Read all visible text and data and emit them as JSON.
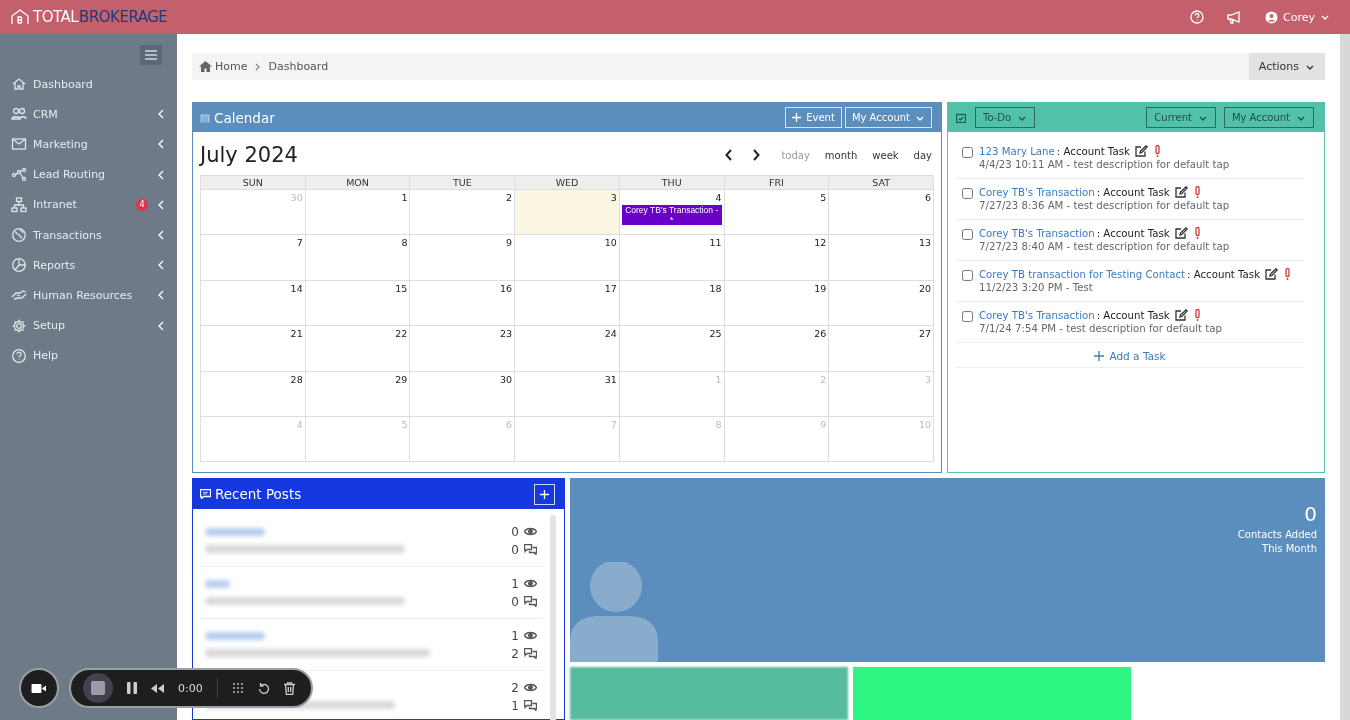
{
  "topbar": {
    "logo_primary": "TOTAL",
    "logo_secondary": "BROKERAGE",
    "user": "Corey"
  },
  "sidebar": {
    "items": [
      {
        "label": "Dashboard",
        "submenu": false
      },
      {
        "label": "CRM",
        "submenu": true
      },
      {
        "label": "Marketing",
        "submenu": true
      },
      {
        "label": "Lead Routing",
        "submenu": true
      },
      {
        "label": "Intranet",
        "submenu": true,
        "badge": "4"
      },
      {
        "label": "Transactions",
        "submenu": true
      },
      {
        "label": "Reports",
        "submenu": true
      },
      {
        "label": "Human Resources",
        "submenu": true
      },
      {
        "label": "Setup",
        "submenu": true
      },
      {
        "label": "Help",
        "submenu": false
      }
    ]
  },
  "breadcrumb": [
    "Home",
    "Dashboard"
  ],
  "actions_button": "Actions",
  "calendar": {
    "title": "Calendar",
    "event_button": "Event",
    "account_button": "My Account",
    "month": "July 2024",
    "nav": [
      {
        "label": "today",
        "disabled": true
      },
      {
        "label": "month",
        "disabled": false
      },
      {
        "label": "week",
        "disabled": false
      },
      {
        "label": "day",
        "disabled": false
      }
    ],
    "weekdays": [
      "SUN",
      "MON",
      "TUE",
      "WED",
      "THU",
      "FRI",
      "SAT"
    ],
    "weeks": [
      [
        {
          "day": "30",
          "other_month": true
        },
        {
          "day": "1"
        },
        {
          "day": "2"
        },
        {
          "day": "3",
          "today": true
        },
        {
          "day": "4",
          "events": [
            {
              "title": "Corey TB's Transaction - *",
              "color": "#6a00c8"
            }
          ]
        },
        {
          "day": "5"
        },
        {
          "day": "6"
        }
      ],
      [
        {
          "day": "7"
        },
        {
          "day": "8"
        },
        {
          "day": "9"
        },
        {
          "day": "10"
        },
        {
          "day": "11"
        },
        {
          "day": "12"
        },
        {
          "day": "13"
        }
      ],
      [
        {
          "day": "14"
        },
        {
          "day": "15"
        },
        {
          "day": "16"
        },
        {
          "day": "17"
        },
        {
          "day": "18"
        },
        {
          "day": "19"
        },
        {
          "day": "20"
        }
      ],
      [
        {
          "day": "21"
        },
        {
          "day": "22"
        },
        {
          "day": "23"
        },
        {
          "day": "24"
        },
        {
          "day": "25"
        },
        {
          "day": "26"
        },
        {
          "day": "27"
        }
      ],
      [
        {
          "day": "28"
        },
        {
          "day": "29"
        },
        {
          "day": "30"
        },
        {
          "day": "31"
        },
        {
          "day": "1",
          "other_month": true
        },
        {
          "day": "2",
          "other_month": true
        },
        {
          "day": "3",
          "other_month": true
        }
      ],
      [
        {
          "day": "4",
          "other_month": true
        },
        {
          "day": "5",
          "other_month": true
        },
        {
          "day": "6",
          "other_month": true
        },
        {
          "day": "7",
          "other_month": true
        },
        {
          "day": "8",
          "other_month": true
        },
        {
          "day": "9",
          "other_month": true
        },
        {
          "day": "10",
          "other_month": true
        }
      ]
    ]
  },
  "todo": {
    "filter": "To-Do",
    "scope": "Current",
    "account": "My Account",
    "add_label": "Add a Task",
    "tasks": [
      {
        "link": "123 Mary Lane",
        "type": ": Account Task",
        "meta": "4/4/23 10:11 AM - test description for default tap",
        "checked": false
      },
      {
        "link": "Corey TB's Transaction",
        "type": ": Account Task",
        "meta": "7/27/23 8:36 AM - test description for default tap",
        "checked": false
      },
      {
        "link": "Corey TB's Transaction",
        "type": ": Account Task",
        "meta": "7/27/23 8:40 AM - test description for default tap",
        "checked": false
      },
      {
        "link": "Corey TB transaction for Testing Contact",
        "type": ": Account Task",
        "meta": "11/2/23 3:20 PM - Test",
        "checked": false
      },
      {
        "link": "Corey TB's Transaction",
        "type": ": Account Task",
        "meta": "7/1/24 7:54 PM - test description for default tap",
        "checked": false
      }
    ]
  },
  "recent_posts": {
    "title": "Recent Posts",
    "posts": [
      {
        "views": "0",
        "comments": "0"
      },
      {
        "views": "1",
        "comments": "0"
      },
      {
        "views": "1",
        "comments": "2"
      },
      {
        "views": "2",
        "comments": "1"
      }
    ]
  },
  "contacts": {
    "count": "0",
    "label_line1": "Contacts Added",
    "label_line2": "This Month"
  },
  "recorder": {
    "time": "0:00"
  }
}
